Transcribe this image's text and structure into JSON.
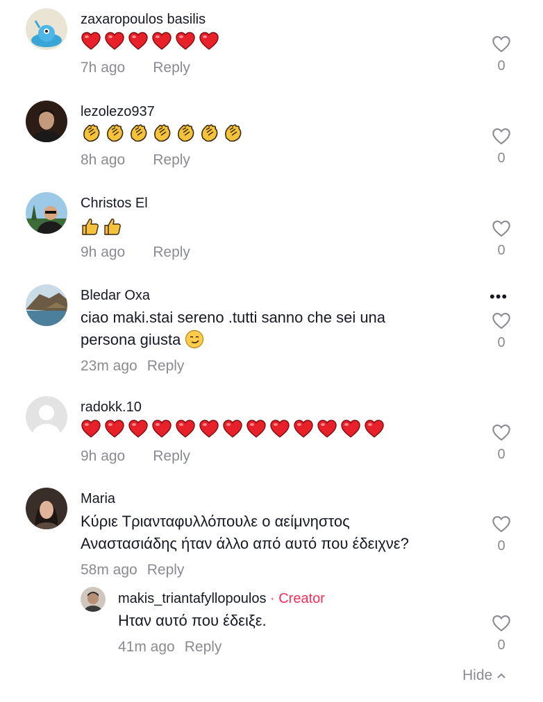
{
  "comments": [
    {
      "username": "zaxaropoulos basilis",
      "emoji": "hearts",
      "emoji_count": 6,
      "time": "7h ago",
      "reply": "Reply",
      "likes": "0"
    },
    {
      "username": "lezolezo937",
      "emoji": "claps",
      "emoji_count": 7,
      "time": "8h ago",
      "reply": "Reply",
      "likes": "0"
    },
    {
      "username": "Christos El",
      "emoji": "thumbs",
      "emoji_count": 2,
      "time": "9h ago",
      "reply": "Reply",
      "likes": "0"
    },
    {
      "username": "Bledar Oxa",
      "text": "ciao maki.stai sereno .tutti sanno che sei una\npersona giusta",
      "time": "23m ago",
      "reply": "Reply",
      "likes": "0"
    },
    {
      "username": "radokk.10",
      "emoji": "hearts",
      "emoji_count": 13,
      "time": "9h ago",
      "reply": "Reply",
      "likes": "0"
    },
    {
      "username": "Maria",
      "text": "Κύριε Τριανταφυλλόπουλε ο αείμνηστος\nΑναστασιάδης ήταν άλλο από αυτό που έδειχνε?",
      "time": "58m ago",
      "reply": "Reply",
      "likes": "0"
    }
  ],
  "reply_comment": {
    "username": "makis_triantafyllopoulos",
    "separator": " · ",
    "badge": "Creator",
    "text": "Ηταν αυτό που έδειξε.",
    "time": "41m ago",
    "reply": "Reply",
    "likes": "0"
  },
  "more_options": "•••",
  "hide_label": "Hide",
  "colors": {
    "heart": "#e8202a",
    "clap": "#f5c33b",
    "text_secondary": "#8a8b91",
    "creator": "#fe2c55"
  }
}
